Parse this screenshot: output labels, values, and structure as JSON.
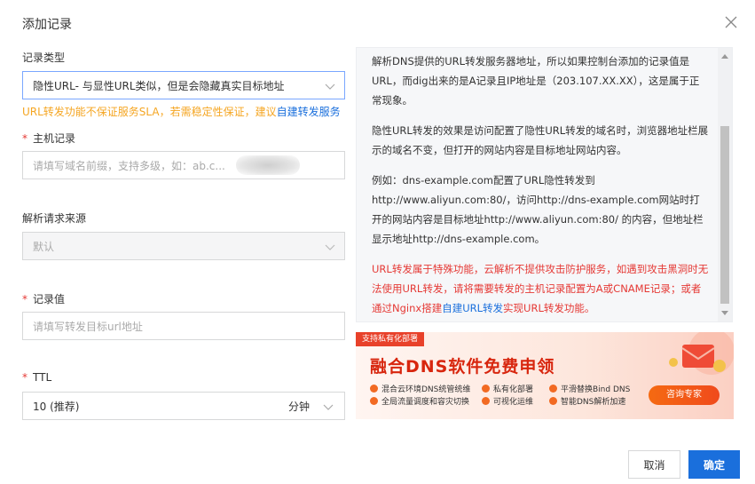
{
  "dialog": {
    "title": "添加记录"
  },
  "record_type": {
    "label": "记录类型",
    "value": "隐性URL- 与显性URL类似，但是会隐藏真实目标地址",
    "warning_text": "URL转发功能不保证服务SLA，若需稳定性保证，建议",
    "warning_link": "自建转发服务"
  },
  "host_record": {
    "required_mark": "*",
    "label": "主机记录",
    "placeholder": "请填写域名前缀，支持多级，如：ab.c..."
  },
  "request_source": {
    "label": "解析请求来源",
    "value": "默认"
  },
  "record_value": {
    "required_mark": "*",
    "label": "记录值",
    "placeholder": "请填写转发目标url地址"
  },
  "ttl": {
    "required_mark": "*",
    "label": "TTL",
    "value": "10 (推荐)",
    "unit": "分钟"
  },
  "info": {
    "p1": "解析DNS提供的URL转发服务器地址，所以如果控制台添加的记录值是URL，而dig出来的是A记录且IP地址是（203.107.XX.XX），这是属于正常现象。",
    "p2": "隐性URL转发的效果是访问配置了隐性URL转发的域名时，浏览器地址栏展示的域名不变，但打开的网站内容是目标地址网站内容。",
    "p3a": "例如：dns-example.com配置了URL隐性转发到",
    "p3b": "http://www.aliyun.com:80/，访问http://dns-example.com网站时打开的网站内容是目标地址http://www.aliyun.com:80/ 的内容，但地址栏显示地址http://dns-example.com。",
    "p4_red": "URL转发属于特殊功能，云解析不提供攻击防护服务，如遇到攻击黑洞时无法使用URL转发，请将需要转发的主机记录配置为A或CNAME记录；或者通过Nginx搭建",
    "p4_link": "自建URL转发",
    "p4_end": "实现URL转发功能。"
  },
  "ad": {
    "tag": "支持私有化部署",
    "title": "融合DNS软件免费申领",
    "features": [
      "混合云环境DNS统管统维",
      "私有化部署",
      "平滑替换Bind DNS",
      "全局流量调度和容灾切换",
      "可视化运维",
      "智能DNS解析加速"
    ],
    "button": "咨询专家",
    "accent_color": "#e8412a"
  },
  "footer": {
    "cancel": "取消",
    "confirm": "确定"
  },
  "colors": {
    "primary": "#1a6fdc",
    "warning": "#f5a623",
    "danger": "#e53935"
  }
}
